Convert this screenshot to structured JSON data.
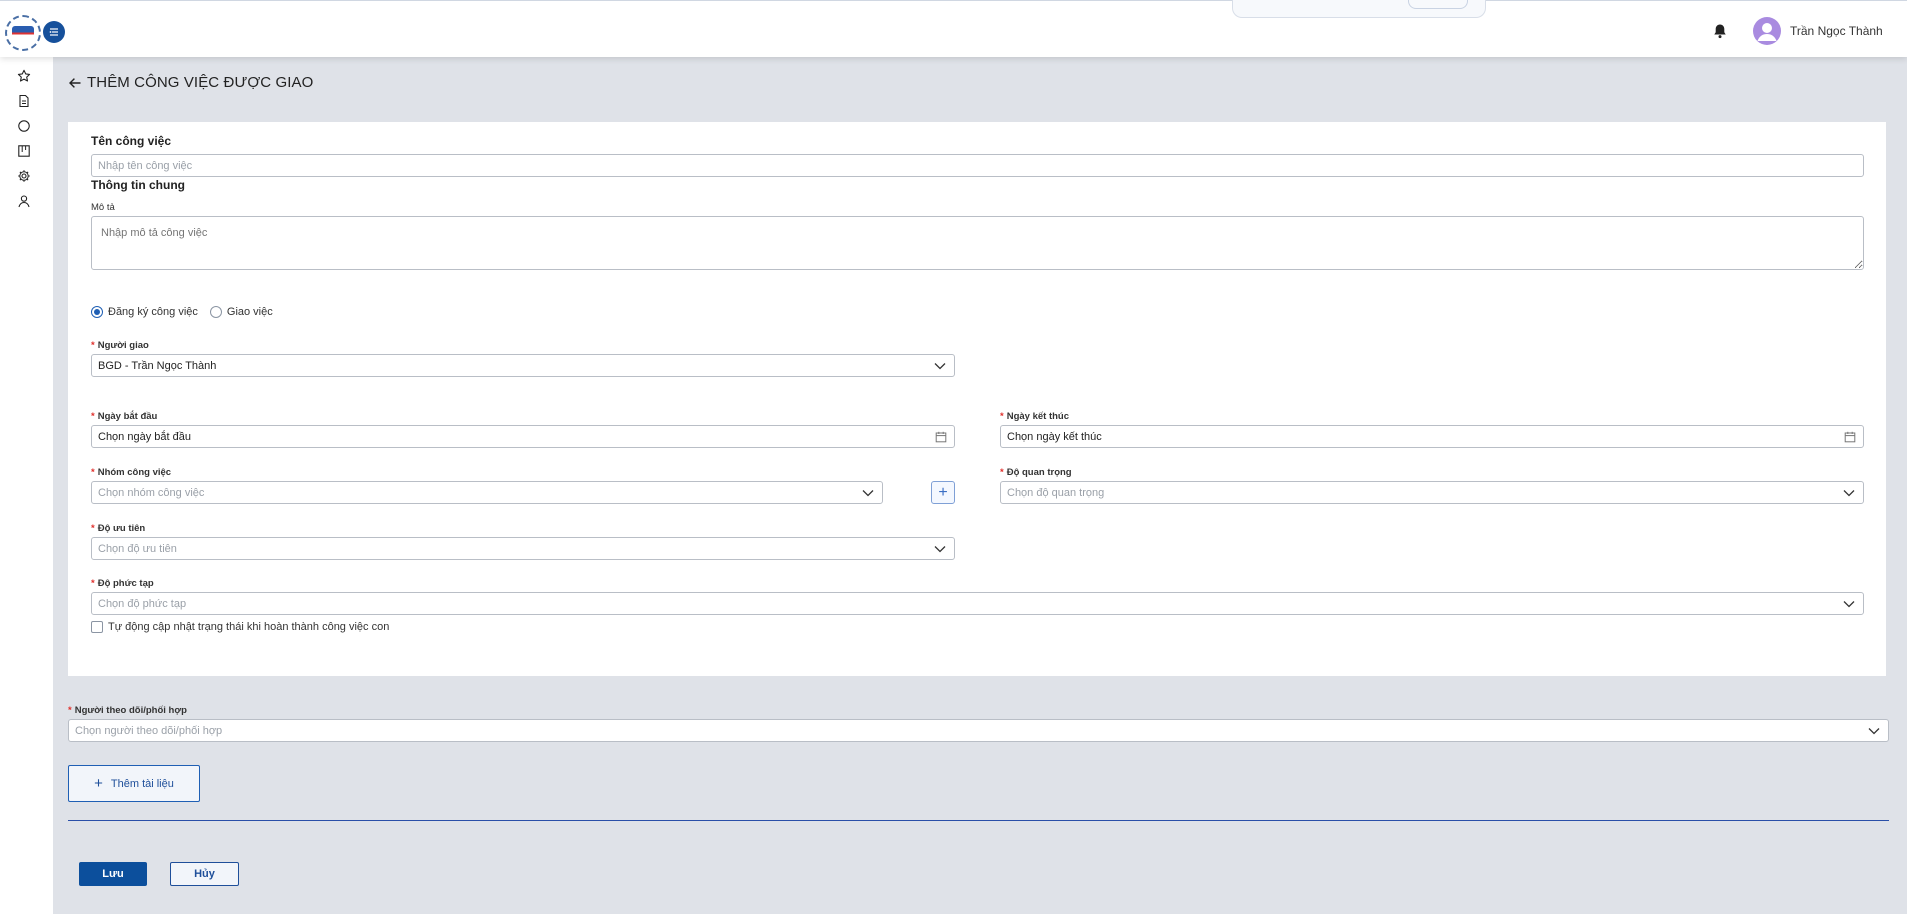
{
  "header": {
    "user_name": "Trần Ngọc Thành",
    "icons": [
      "logo",
      "menu-toggle-icon",
      "bell-icon",
      "avatar-icon"
    ]
  },
  "sidebar": {
    "icons": [
      "star-icon",
      "document-icon",
      "circle-icon",
      "board-icon",
      "gear-icon",
      "user-icon"
    ]
  },
  "page": {
    "title": "THÊM CÔNG VIỆC ĐƯỢC GIAO",
    "back_icon": "arrow-left-icon"
  },
  "form": {
    "task_name": {
      "label": "Tên công việc",
      "placeholder": "Nhập tên công việc"
    },
    "general_info_label": "Thông tin chung",
    "description": {
      "label": "Mô tả",
      "placeholder": "Nhập mô tả công việc"
    },
    "mode_options": [
      {
        "label": "Đăng ký công việc",
        "checked": true
      },
      {
        "label": "Giao việc",
        "checked": false
      }
    ],
    "assigner": {
      "label": "Người giao",
      "value": "BGD - Trần Ngọc Thành"
    },
    "start_date": {
      "label": "Ngày bắt đầu",
      "value": "Chọn ngày bắt đầu"
    },
    "end_date": {
      "label": "Ngày kết thúc",
      "value": "Chọn ngày kết thúc"
    },
    "task_group": {
      "label": "Nhóm công việc",
      "placeholder": "Chọn nhóm công việc",
      "add_symbol": "+"
    },
    "importance": {
      "label": "Độ quan trọng",
      "placeholder": "Chọn độ quan trọng"
    },
    "priority": {
      "label": "Độ ưu tiên",
      "placeholder": "Chọn độ ưu tiên"
    },
    "complexity": {
      "label": "Độ phức tạp",
      "placeholder": "Chọn độ phức tạp"
    },
    "auto_update": {
      "label": "Tự động cập nhật trạng thái khi hoàn thành công việc con",
      "checked": false
    },
    "required_marker": "*"
  },
  "followers": {
    "label": "Người theo dõi/phối hợp",
    "placeholder": "Chọn người theo dõi/phối hợp"
  },
  "actions": {
    "add_document": "Thêm tài liệu",
    "add_document_symbol": "+",
    "save": "Lưu",
    "cancel": "Hủy"
  },
  "colors": {
    "primary": "#0c4f9c",
    "required": "#e0302c",
    "background": "#dfe2e8"
  }
}
